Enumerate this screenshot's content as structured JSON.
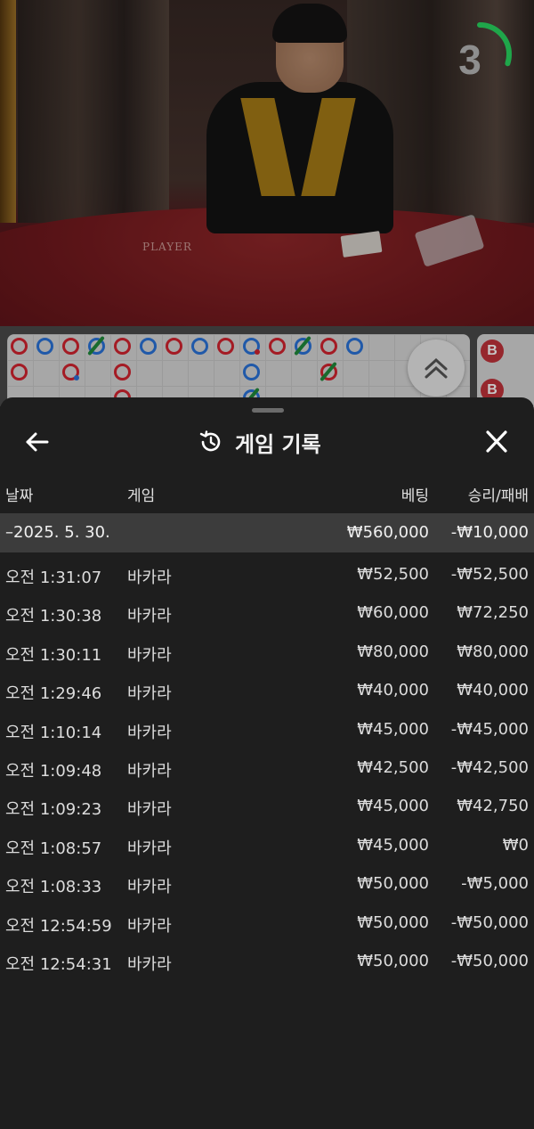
{
  "video": {
    "table_label": "PLAYER",
    "countdown": "3",
    "countdown_progress": 0.3
  },
  "roadmap": {
    "bead_labels": [
      "B",
      "B"
    ]
  },
  "sheet": {
    "title": "게임 기록",
    "icons": {
      "back": "arrow-left-icon",
      "history": "history-icon",
      "close": "close-icon",
      "scroll": "chevron-double-up-icon"
    },
    "columns": {
      "date": "날짜",
      "game": "게임",
      "bet": "베팅",
      "result": "승리/패배"
    },
    "summary": {
      "date": "–2025. 5. 30.",
      "bet": "₩560,000",
      "result": "-₩10,000"
    },
    "rows": [
      {
        "time": "오전 1:31:07",
        "game": "바카라",
        "bet": "₩52,500",
        "result": "-₩52,500"
      },
      {
        "time": "오전 1:30:38",
        "game": "바카라",
        "bet": "₩60,000",
        "result": "₩72,250"
      },
      {
        "time": "오전 1:30:11",
        "game": "바카라",
        "bet": "₩80,000",
        "result": "₩80,000"
      },
      {
        "time": "오전 1:29:46",
        "game": "바카라",
        "bet": "₩40,000",
        "result": "₩40,000"
      },
      {
        "time": "오전 1:10:14",
        "game": "바카라",
        "bet": "₩45,000",
        "result": "-₩45,000"
      },
      {
        "time": "오전 1:09:48",
        "game": "바카라",
        "bet": "₩42,500",
        "result": "-₩42,500"
      },
      {
        "time": "오전 1:09:23",
        "game": "바카라",
        "bet": "₩45,000",
        "result": "₩42,750"
      },
      {
        "time": "오전 1:08:57",
        "game": "바카라",
        "bet": "₩45,000",
        "result": "₩0"
      },
      {
        "time": "오전 1:08:33",
        "game": "바카라",
        "bet": "₩50,000",
        "result": "-₩5,000"
      },
      {
        "time": "오전 12:54:59",
        "game": "바카라",
        "bet": "₩50,000",
        "result": "-₩50,000"
      },
      {
        "time": "오전 12:54:31",
        "game": "바카라",
        "bet": "₩50,000",
        "result": "-₩50,000"
      }
    ]
  }
}
